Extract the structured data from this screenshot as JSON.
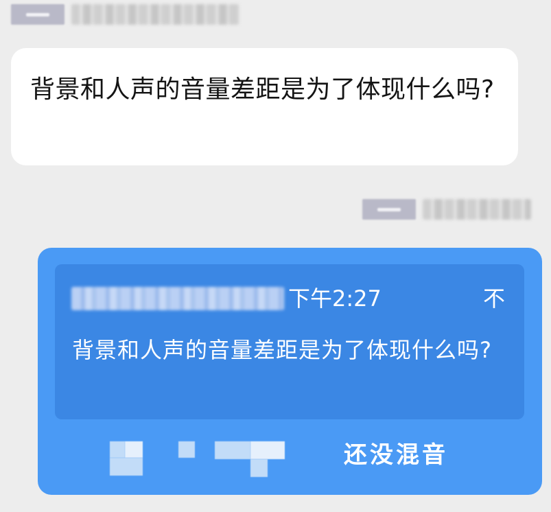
{
  "incoming": {
    "message": "背景和人声的音量差距是为了体现什么吗?"
  },
  "outgoing": {
    "quote": {
      "time": "下午2:27",
      "pin_icon": "不",
      "text": "背景和人声的音量差距是为了体现什么吗?"
    },
    "reply": "还没混音"
  },
  "colors": {
    "background": "#ededed",
    "incoming_bubble": "#ffffff",
    "outgoing_bubble": "#4a9af5",
    "quote_box": "#3b87e4"
  }
}
